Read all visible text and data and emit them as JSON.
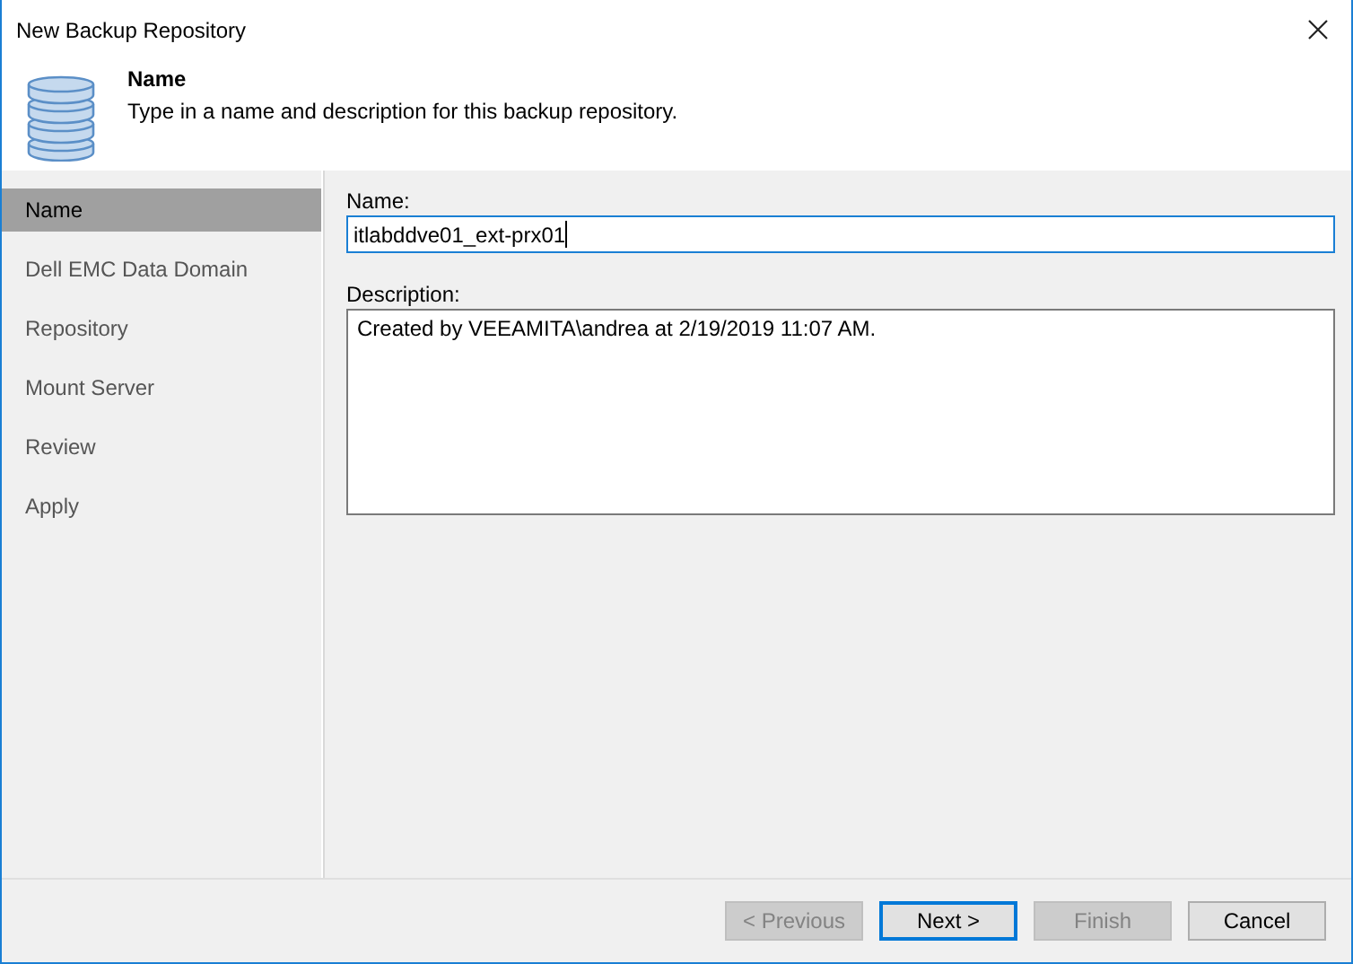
{
  "window": {
    "title": "New Backup Repository"
  },
  "header": {
    "title": "Name",
    "description": "Type in a name and description for this backup repository."
  },
  "steps": [
    {
      "label": "Name",
      "selected": true
    },
    {
      "label": "Dell EMC Data Domain",
      "selected": false
    },
    {
      "label": "Repository",
      "selected": false
    },
    {
      "label": "Mount Server",
      "selected": false
    },
    {
      "label": "Review",
      "selected": false
    },
    {
      "label": "Apply",
      "selected": false
    }
  ],
  "form": {
    "name_label": "Name:",
    "name_value": "itlabddve01_ext-prx01",
    "description_label": "Description:",
    "description_value": "Created by VEEAMITA\\andrea at 2/19/2019 11:07 AM."
  },
  "buttons": [
    {
      "label": "< Previous",
      "disabled": true,
      "focused": false
    },
    {
      "label": "Next >",
      "disabled": false,
      "focused": true
    },
    {
      "label": "Finish",
      "disabled": true,
      "focused": false
    },
    {
      "label": "Cancel",
      "disabled": false,
      "focused": false
    }
  ]
}
